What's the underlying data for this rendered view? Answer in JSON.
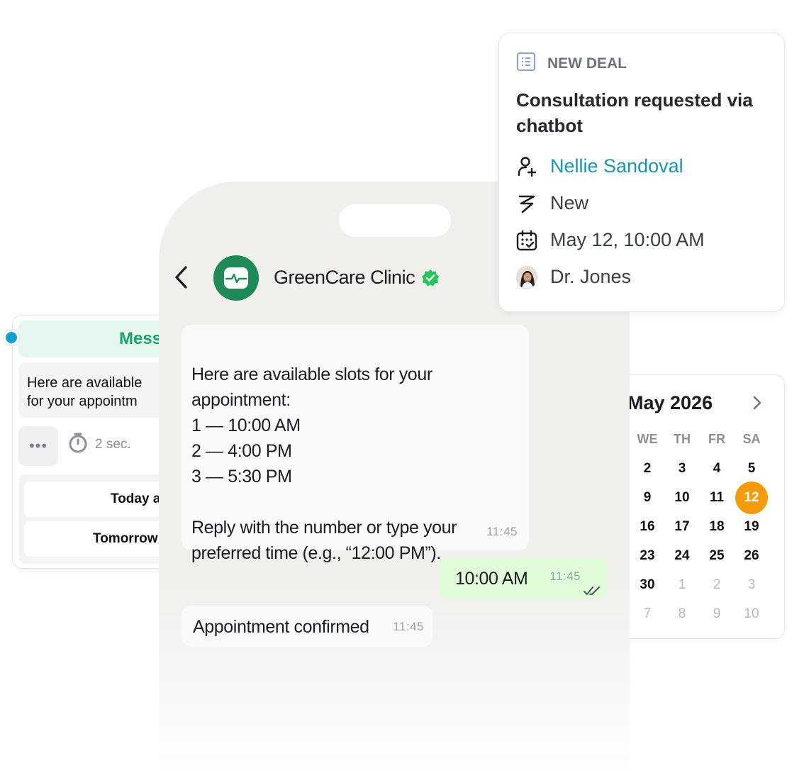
{
  "flow": {
    "header": "Mess",
    "message_preview": "Here are available\nfor your appointm",
    "typing_indicator": "•••",
    "delay": "2 sec.",
    "replies": [
      "Today a",
      "Tomorrow"
    ]
  },
  "calendar": {
    "month_label": "May 2026",
    "weekday_headers": [
      "WE",
      "TH",
      "FR",
      "SA"
    ],
    "weeks": [
      [
        "2",
        "3",
        "4",
        "5"
      ],
      [
        "9",
        "10",
        "11",
        "12"
      ],
      [
        "16",
        "17",
        "18",
        "19"
      ],
      [
        "23",
        "24",
        "25",
        "26"
      ],
      [
        "30",
        "1",
        "2",
        "3"
      ],
      [
        "7",
        "8",
        "9",
        "10"
      ]
    ],
    "selected_day": "12",
    "selected_color": "#f59a0b"
  },
  "chat": {
    "contact_name": "GreenCare Clinic",
    "brand_color": "#1f8a58",
    "messages": [
      {
        "direction": "incoming",
        "text": "Here are available slots for your appointment:\n1 — 10:00 AM\n2 — 4:00 PM\n3 — 5:30 PM\n\nReply with the number or type your preferred time (e.g., “12:00 PM”).",
        "time": "11:45"
      },
      {
        "direction": "outgoing",
        "text": "10:00 AM",
        "time": "11:45"
      },
      {
        "direction": "incoming",
        "text": "Appointment confirmed",
        "time": "11:45"
      }
    ]
  },
  "deal": {
    "tag": "NEW DEAL",
    "title": "Consultation requested via chatbot",
    "contact": "Nellie Sandoval",
    "stage": "New",
    "date": "May 12, 10:00 AM",
    "owner": "Dr. Jones",
    "contact_color": "#1896b0"
  }
}
